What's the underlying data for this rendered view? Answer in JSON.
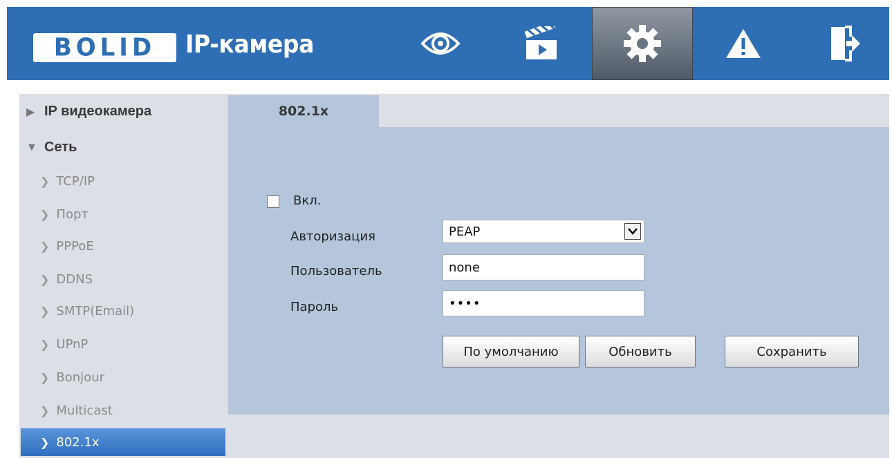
{
  "header": {
    "logo": "BOLID",
    "title": "IP-камера",
    "nav": [
      {
        "icon": "eye-icon"
      },
      {
        "icon": "clapperboard-icon"
      },
      {
        "icon": "gear-icon",
        "active": true
      },
      {
        "icon": "warning-icon"
      },
      {
        "icon": "exit-icon"
      }
    ]
  },
  "sidebar": {
    "group_camera": "IP видеокамера",
    "group_network": "Сеть",
    "items": [
      "TCP/IP",
      "Порт",
      "PPPoE",
      "DDNS",
      "SMTP(Email)",
      "UPnP",
      "Bonjour",
      "Multicast",
      "802.1x"
    ],
    "active_item": "802.1x"
  },
  "main": {
    "tab": "802.1x",
    "enable_label": "Вкл.",
    "enable_checked": false,
    "auth_label": "Авторизация",
    "auth_value": "PEAP",
    "user_label": "Пользователь",
    "user_value": "none",
    "password_label": "Пароль",
    "password_value": "••••",
    "buttons": {
      "default": "По умолчанию",
      "refresh": "Обновить",
      "save": "Сохранить"
    }
  },
  "colors": {
    "header_bg": "#2e6eb5",
    "panel_bg": "#b5c5db",
    "sidebar_bg": "#dcdfe5",
    "active_item": "#3f7fcc"
  }
}
